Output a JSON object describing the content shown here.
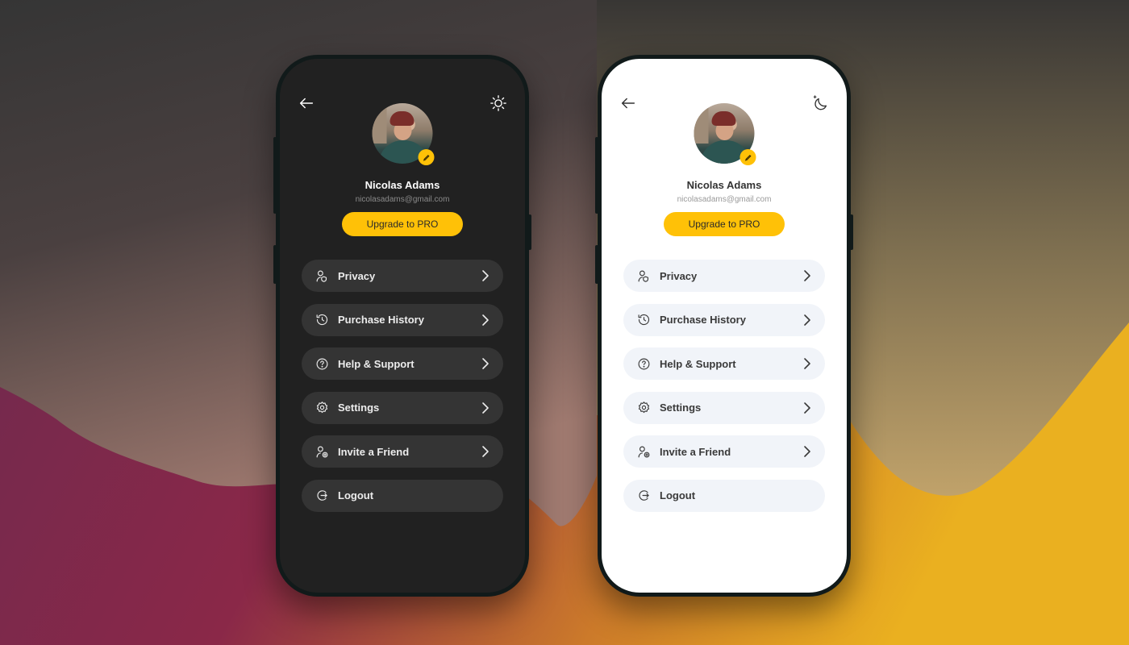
{
  "colors": {
    "accent": "#ffc107",
    "dark_screen": "#212121",
    "dark_item": "#343434",
    "light_screen": "#ffffff",
    "light_item": "#f1f4f9"
  },
  "phones": [
    {
      "theme": "dark",
      "back_icon": "arrow-left-icon",
      "theme_toggle_icon": "sun-icon",
      "profile": {
        "name": "Nicolas Adams",
        "email": "nicolasadams@gmail.com",
        "avatar_icon": "profile-photo",
        "edit_icon": "pencil-icon"
      },
      "upgrade_label": "Upgrade to PRO",
      "menu": [
        {
          "label": "Privacy",
          "icon": "user-shield-icon",
          "chevron": true
        },
        {
          "label": "Purchase History",
          "icon": "history-icon",
          "chevron": true
        },
        {
          "label": "Help & Support",
          "icon": "help-circle-icon",
          "chevron": true
        },
        {
          "label": "Settings",
          "icon": "gear-icon",
          "chevron": true
        },
        {
          "label": "Invite a Friend",
          "icon": "user-plus-icon",
          "chevron": true
        },
        {
          "label": "Logout",
          "icon": "logout-icon",
          "chevron": false
        }
      ]
    },
    {
      "theme": "light",
      "back_icon": "arrow-left-icon",
      "theme_toggle_icon": "moon-stars-icon",
      "profile": {
        "name": "Nicolas Adams",
        "email": "nicolasadams@gmail.com",
        "avatar_icon": "profile-photo",
        "edit_icon": "pencil-icon"
      },
      "upgrade_label": "Upgrade to PRO",
      "menu": [
        {
          "label": "Privacy",
          "icon": "user-shield-icon",
          "chevron": true
        },
        {
          "label": "Purchase History",
          "icon": "history-icon",
          "chevron": true
        },
        {
          "label": "Help & Support",
          "icon": "help-circle-icon",
          "chevron": true
        },
        {
          "label": "Settings",
          "icon": "gear-icon",
          "chevron": true
        },
        {
          "label": "Invite a Friend",
          "icon": "user-plus-icon",
          "chevron": true
        },
        {
          "label": "Logout",
          "icon": "logout-icon",
          "chevron": false
        }
      ]
    }
  ]
}
